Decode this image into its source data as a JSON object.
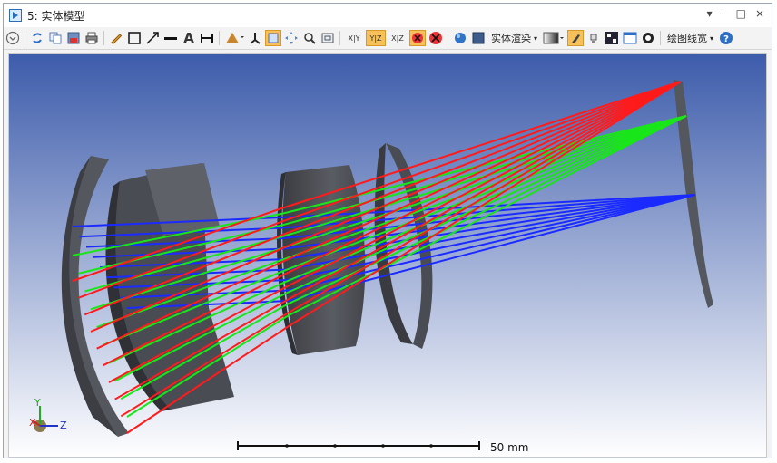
{
  "window": {
    "title": "5: 实体模型",
    "controls": {
      "dropdown": "▾",
      "minimize": "–",
      "restore": "□",
      "close": "×"
    }
  },
  "toolbar": {
    "render_menu": "实体渲染",
    "line_width_menu": "绘图线宽",
    "xy_label": "X|Y",
    "yz_label": "Y|Z",
    "xz_label": "X|Z",
    "text_tool": "A",
    "icons": [
      "settings-circle-icon",
      "refresh-icon",
      "copy-icon",
      "save-image-icon",
      "print-icon",
      "pencil-icon",
      "rectangle-icon",
      "arrow-icon",
      "line-icon",
      "text-icon",
      "dimension-icon",
      "lens-icon",
      "axes-icon",
      "pan-box-icon",
      "move-icon",
      "zoom-icon",
      "zoom-window-icon",
      "rotate-icon",
      "stop-icon",
      "sphere-icon",
      "solid-icon",
      "gradient-icon",
      "brush-icon",
      "lamp-icon",
      "grid-icon",
      "window-icon",
      "target-icon",
      "help-icon"
    ]
  },
  "viewport": {
    "background_top": "#3d5cab",
    "background_bottom": "#ffffff",
    "ray_colors": {
      "red": "#ff1b1b",
      "green": "#19e619",
      "blue": "#1b2bff"
    },
    "axis_labels": {
      "y": "Y",
      "x": "X",
      "z": "Z"
    },
    "scale_bar_label": "50 mm"
  }
}
